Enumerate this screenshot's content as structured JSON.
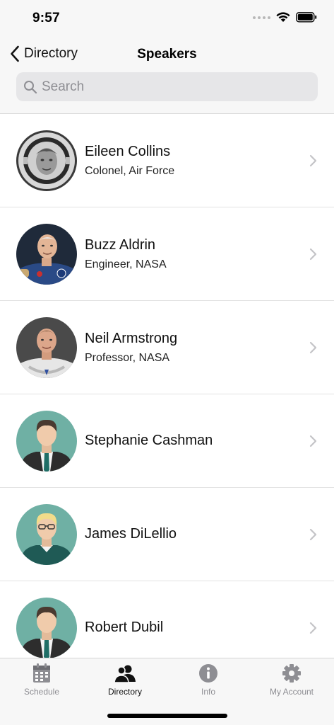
{
  "status_bar": {
    "time": "9:57"
  },
  "header": {
    "back_label": "Directory",
    "title": "Speakers",
    "search_placeholder": "Search"
  },
  "speakers": [
    {
      "name": "Eileen Collins",
      "title": "Colonel, Air Force",
      "avatar": "astronaut-helmet-photo"
    },
    {
      "name": "Buzz Aldrin",
      "title": "Engineer, NASA",
      "avatar": "astronaut-flight-suit-photo"
    },
    {
      "name": "Neil Armstrong",
      "title": "Professor, NASA",
      "avatar": "astronaut-spacesuit-photo"
    },
    {
      "name": "Stephanie Cashman",
      "title": "",
      "avatar": "default-man-dark-hair"
    },
    {
      "name": "James DiLellio",
      "title": "",
      "avatar": "default-man-blond-glasses"
    },
    {
      "name": "Robert Dubil",
      "title": "",
      "avatar": "default-man-dark-hair"
    }
  ],
  "tabs": [
    {
      "label": "Schedule",
      "icon": "calendar-icon",
      "active": false
    },
    {
      "label": "Directory",
      "icon": "people-icon",
      "active": true
    },
    {
      "label": "Info",
      "icon": "info-icon",
      "active": false
    },
    {
      "label": "My Account",
      "icon": "gear-icon",
      "active": false
    }
  ],
  "colors": {
    "avatar_bg": "#6fb0a4",
    "active_tab": "#111111",
    "inactive_tab": "#8e8e93"
  }
}
